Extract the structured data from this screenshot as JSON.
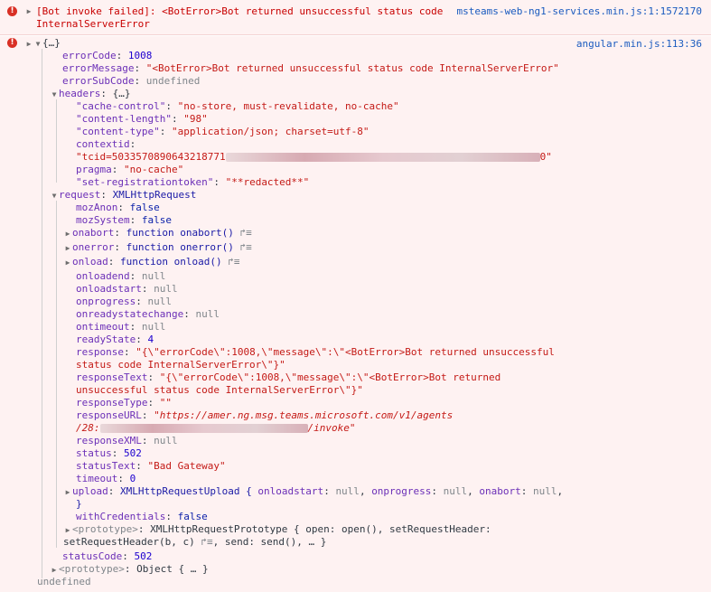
{
  "msg1": {
    "text_line1": "[Bot invoke failed]: <BotError>Bot returned unsuccessful status code",
    "text_line2": "InternalServerError",
    "source": "msteams-web-ng1-services.min.js:1:1572170"
  },
  "msg2": {
    "summary": "{…}",
    "source": "angular.min.js:113:36",
    "errorCode": {
      "k": "errorCode",
      "v": "1008"
    },
    "errorMessage": {
      "k": "errorMessage",
      "v": "\"<BotError>Bot returned unsuccessful status code InternalServerError\""
    },
    "errorSubCode": {
      "k": "errorSubCode",
      "v": "undefined"
    },
    "headers": {
      "k": "headers",
      "v": "{…}",
      "cache_control": {
        "k": "\"cache-control\"",
        "v": "\"no-store, must-revalidate, no-cache\""
      },
      "content_length": {
        "k": "\"content-length\"",
        "v": "\"98\""
      },
      "content_type": {
        "k": "\"content-type\"",
        "v": "\"application/json; charset=utf-8\""
      },
      "contextid": {
        "k": "contextid",
        "v1": "\"tcid=5033570890643218771",
        "v2": "0\""
      },
      "pragma": {
        "k": "pragma",
        "v": "\"no-cache\""
      },
      "set_registrationtoken": {
        "k": "\"set-registrationtoken\"",
        "v": "\"**redacted**\""
      }
    },
    "request": {
      "k": "request",
      "v": "XMLHttpRequest",
      "mozAnon": {
        "k": "mozAnon",
        "v": "false"
      },
      "mozSystem": {
        "k": "mozSystem",
        "v": "false"
      },
      "onabort": {
        "k": "onabort",
        "v": "function onabort()"
      },
      "onerror": {
        "k": "onerror",
        "v": "function onerror()"
      },
      "onload": {
        "k": "onload",
        "v": "function onload()"
      },
      "onloadend": {
        "k": "onloadend",
        "v": "null"
      },
      "onloadstart": {
        "k": "onloadstart",
        "v": "null"
      },
      "onprogress": {
        "k": "onprogress",
        "v": "null"
      },
      "onreadystatechange": {
        "k": "onreadystatechange",
        "v": "null"
      },
      "ontimeout": {
        "k": "ontimeout",
        "v": "null"
      },
      "readyState": {
        "k": "readyState",
        "v": "4"
      },
      "response": {
        "k": "response",
        "v1": "\"{\\\"errorCode\\\":1008,\\\"message\\\":\\\"<BotError>Bot returned unsuccessful",
        "v2": "status code InternalServerError\\\"}\""
      },
      "responseText": {
        "k": "responseText",
        "v1": "\"{\\\"errorCode\\\":1008,\\\"message\\\":\\\"<BotError>Bot returned",
        "v2": "unsuccessful status code InternalServerError\\\"}\""
      },
      "responseType": {
        "k": "responseType",
        "v": "\"\""
      },
      "responseURL": {
        "k": "responseURL",
        "v1": "\"https://amer.ng.msg.teams.microsoft.com/v1/agents",
        "v2a": "/28:",
        "v2b": "/invoke\""
      },
      "responseXML": {
        "k": "responseXML",
        "v": "null"
      },
      "status": {
        "k": "status",
        "v": "502"
      },
      "statusText": {
        "k": "statusText",
        "v": "\"Bad Gateway\""
      },
      "timeout": {
        "k": "timeout",
        "v": "0"
      },
      "upload": {
        "k": "upload",
        "v": "XMLHttpRequestUpload {",
        "p1k": "onloadstart",
        "p1v": "null",
        "p2k": "onprogress",
        "p2v": "null",
        "p3k": "onabort",
        "p3v": "null",
        "tail": ",",
        "close": "}"
      },
      "withCredentials": {
        "k": "withCredentials",
        "v": "false"
      },
      "prototype": {
        "k": "<prototype>",
        "v1": "XMLHttpRequestPrototype { open: open(), setRequestHeader:",
        "v2a": "setRequestHeader(b, c)",
        "v2b": ", send: send(), … }"
      }
    },
    "statusCode": {
      "k": "statusCode",
      "v": "502"
    },
    "prototype": {
      "k": "<prototype>",
      "v": "Object { … }"
    }
  },
  "footer": "undefined"
}
